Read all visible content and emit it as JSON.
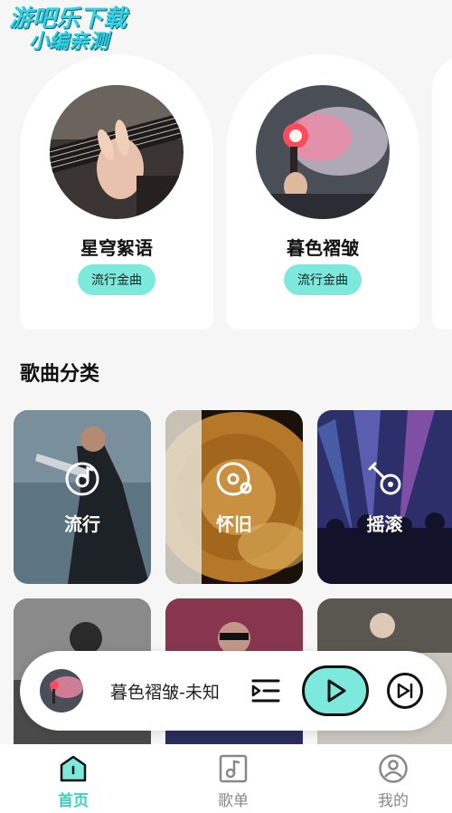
{
  "watermark": {
    "line1": "游吧乐下载",
    "line2": "小编亲测"
  },
  "top_cards": [
    {
      "title": "星穹絮语",
      "tag": "流行金曲"
    },
    {
      "title": "暮色褶皱",
      "tag": "流行金曲"
    }
  ],
  "section": {
    "title": "歌曲分类"
  },
  "categories": [
    {
      "label": "流行",
      "icon": "vinyl-record-icon"
    },
    {
      "label": "怀旧",
      "icon": "cassette-disc-icon"
    },
    {
      "label": "摇滚",
      "icon": "guitar-icon"
    }
  ],
  "player": {
    "now_playing": "暮色褶皱-未知",
    "accent": "#7de8dc"
  },
  "tabs": [
    {
      "label": "首页",
      "icon": "home-icon",
      "active": true,
      "color": "#3ecfc1"
    },
    {
      "label": "歌单",
      "icon": "music-note-icon",
      "active": false,
      "color": "#888888"
    },
    {
      "label": "我的",
      "icon": "profile-icon",
      "active": false,
      "color": "#888888"
    }
  ]
}
